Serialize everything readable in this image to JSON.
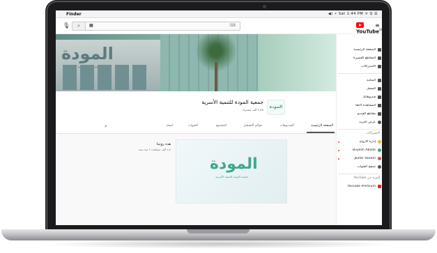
{
  "menubar": {
    "apple": "",
    "app": "Finder",
    "status": "◀) ⚡ Sat 1:44 PM ᯤ Q ☰"
  },
  "ytbar": {
    "search_value": "▦",
    "logo": "YouTube",
    "logo_sup": "SA"
  },
  "sidebar": {
    "items": [
      {
        "label": "الصفحة الرئيسية",
        "icon": "home-icon"
      },
      {
        "label": "المقاطع القصيرة",
        "icon": "shorts-icon"
      },
      {
        "label": "الاشتراكات",
        "icon": "subscriptions-icon"
      },
      {
        "label": "المكتبة",
        "icon": "library-icon"
      },
      {
        "label": "السجل",
        "icon": "history-icon"
      },
      {
        "label": "فيديوهاتك",
        "icon": "your-videos-icon"
      },
      {
        "label": "المشاهدة لاحقًا",
        "icon": "watch-later-icon"
      },
      {
        "label": "مقاطع الفيديو",
        "icon": "liked-icon"
      },
      {
        "label": "عرض المزيد",
        "icon": "expand-icon"
      }
    ],
    "subs_heading": "الاشتراكات",
    "subs": [
      {
        "label": "إدارة الأزواج",
        "icon": "channel-avatar-icon"
      },
      {
        "label": "Buyesh Abode",
        "icon": "channel-avatar-icon"
      },
      {
        "label": "Jaafar Akeem",
        "icon": "channel-avatar-icon"
      },
      {
        "label": "تصفح القنوات",
        "icon": "browse-channels-icon"
      }
    ],
    "more_heading": "المزيد من YouTube",
    "more": [
      {
        "label": "YouTube Premium",
        "icon": "premium-icon"
      }
    ]
  },
  "channel": {
    "name": "جمعية المودة للتنمية الأسرية",
    "subs": "٣٫٤٨ ألف مشترك",
    "logo_text": "المودة",
    "tabs": [
      "الصفحة الرئيسية",
      "الفيديوهات",
      "قوائم التشغيل",
      "المجتمع",
      "القنوات",
      "لمحة"
    ],
    "active_tab": 0
  },
  "featured": {
    "title": "هذه رؤيتنا",
    "meta": "٤٫٨ ألف مشاهدة • منذ سنة",
    "thumb_logo": "المودة",
    "thumb_sub": "جمعية المودة للتنمية الأسرية"
  },
  "banner": {
    "sign": "المودة",
    "sign_sub": "جمعية المودة للتنمية الأسرية"
  }
}
